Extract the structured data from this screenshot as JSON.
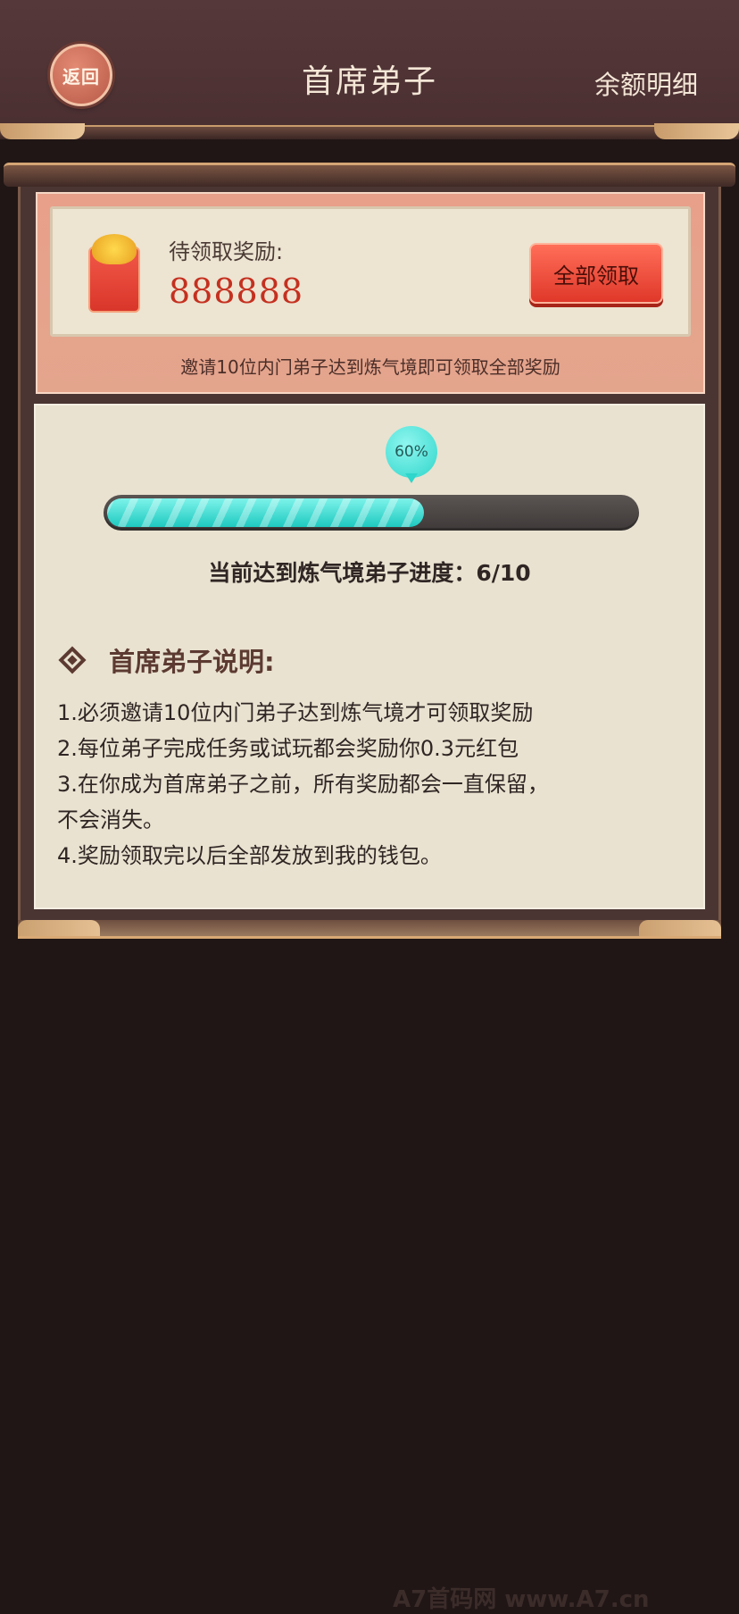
{
  "header": {
    "back_label": "返回",
    "title": "首席弟子",
    "balance_link": "余额明细"
  },
  "reward": {
    "label": "待领取奖励:",
    "amount": "888888",
    "claim_all_label": "全部领取",
    "invite_tip": "邀请10位内门弟子达到炼气境即可领取全部奖励"
  },
  "progress": {
    "percent_label": "60%",
    "fraction": 0.6,
    "text": "当前达到炼气境弟子进度：6/10"
  },
  "description": {
    "title": "首席弟子说明:",
    "lines": [
      "1.必须邀请10位内门弟子达到炼气境才可领取奖励",
      "2.每位弟子完成任务或试玩都会奖励你0.3元红包",
      "3.在你成为首席弟子之前，所有奖励都会一直保留，",
      "不会消失。",
      "4.奖励领取完以后全部发放到我的钱包。"
    ]
  },
  "watermark": "A7首码网    www.A7.cn",
  "colors": {
    "accent_teal": "#2ed6cb",
    "amount_red": "#c5301f",
    "button_red": "#e0382a"
  }
}
